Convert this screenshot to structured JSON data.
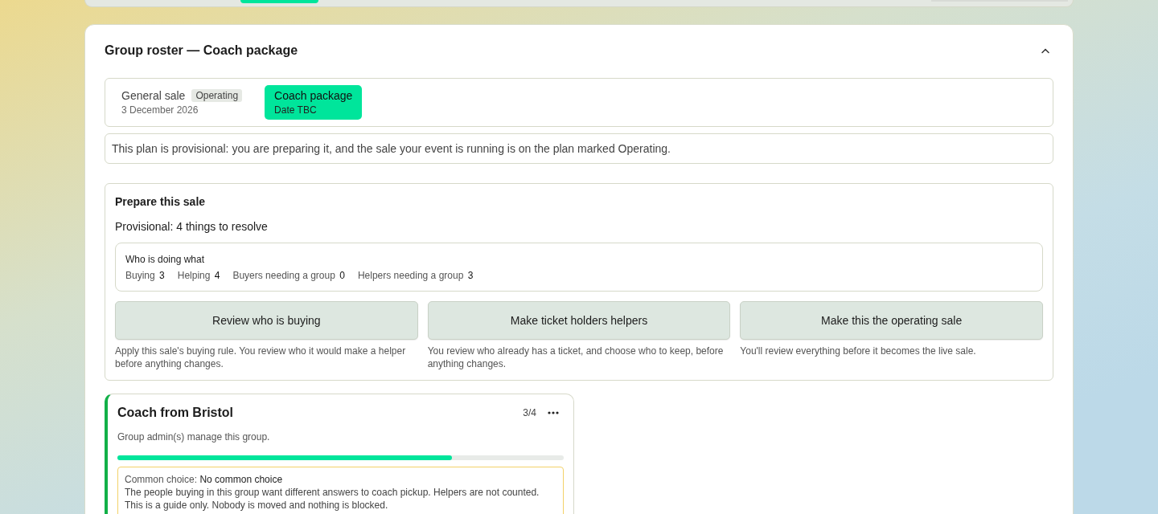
{
  "section": {
    "title": "Group roster — Coach package",
    "expanded": true
  },
  "plans": [
    {
      "name": "General sale",
      "badge": "Operating",
      "date": "3 December 2026",
      "selected": false
    },
    {
      "name": "Coach package",
      "date": "Date TBC",
      "selected": true
    }
  ],
  "notice": "This plan is provisional: you are preparing it, and the sale your event is running is on the plan marked Operating.",
  "prepare": {
    "title": "Prepare this sale",
    "status": "Provisional: 4 things to resolve",
    "summary": {
      "title": "Who is doing what",
      "stats": [
        {
          "label": "Buying",
          "value": "3"
        },
        {
          "label": "Helping",
          "value": "4"
        },
        {
          "label": "Buyers needing a group",
          "value": "0"
        },
        {
          "label": "Helpers needing a group",
          "value": "3"
        }
      ]
    },
    "actions": [
      {
        "label": "Review who is buying",
        "description": "Apply this sale's buying rule. You review who it would make a helper before anything changes."
      },
      {
        "label": "Make ticket holders helpers",
        "description": "You review who already has a ticket, and choose who to keep, before anything changes."
      },
      {
        "label": "Make this the operating sale",
        "description": "You'll review everything before it becomes the live sale."
      }
    ]
  },
  "group": {
    "title": "Coach from Bristol",
    "count": "3/4",
    "description": "Group admin(s) manage this group.",
    "level": 0.75,
    "choice": {
      "label": "Common choice:",
      "value": "No common choice",
      "text": "The people buying in this group want different answers to coach pickup. Helpers are not counted. This is a guide only. Nobody is moved and nothing is blocked."
    }
  }
}
